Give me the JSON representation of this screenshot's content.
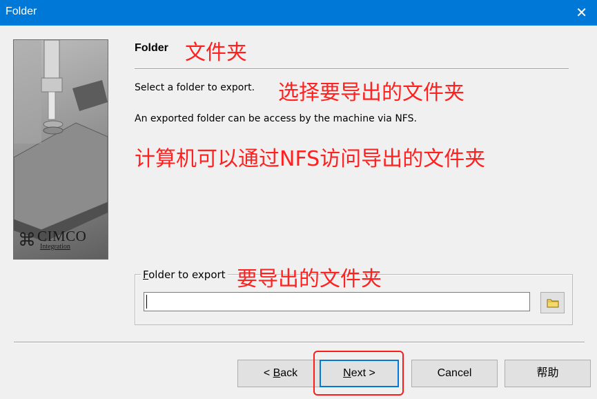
{
  "window": {
    "title": "Folder",
    "close_glyph": "✕"
  },
  "side_panel": {
    "logo_brand": "CIMCO",
    "logo_sub": "Integration"
  },
  "page": {
    "heading": "Folder",
    "select_text": "Select a folder to export.",
    "info_text": "An exported folder can be access by the machine via NFS."
  },
  "annotations": {
    "heading_zh": "文件夹",
    "select_zh": "选择要导出的文件夹",
    "info_zh": "计算机可以通过NFS访问导出的文件夹",
    "group_zh": "要导出的文件夹",
    "color": "#ff2020"
  },
  "folder_group": {
    "label_prefix": "F",
    "label_rest": "older to export",
    "input_value": "",
    "browse_icon": "folder-icon"
  },
  "buttons": {
    "back_prefix": "< ",
    "back_key": "B",
    "back_rest": "ack",
    "next_key": "N",
    "next_rest": "ext >",
    "cancel": "Cancel",
    "help": "帮助"
  },
  "colors": {
    "accent": "#0078d7",
    "highlight": "#ff1a1a"
  }
}
